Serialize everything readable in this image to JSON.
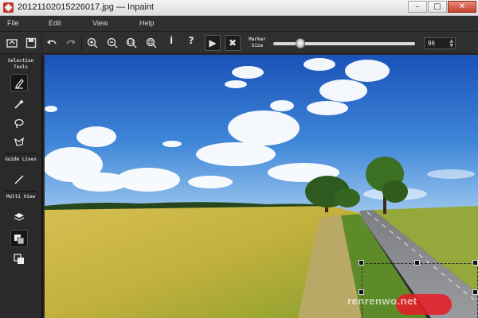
{
  "window": {
    "title": "20121102015226017.jpg — Inpaint",
    "controls": [
      "minimize",
      "maximize",
      "close"
    ]
  },
  "menu": [
    {
      "label": "File"
    },
    {
      "label": "Edit"
    },
    {
      "label": "View"
    },
    {
      "label": "Help"
    }
  ],
  "toolbar": {
    "buttons": [
      {
        "icon": "open-icon"
      },
      {
        "icon": "save-icon"
      },
      {
        "icon": "undo-icon"
      },
      {
        "icon": "redo-icon"
      },
      {
        "icon": "zoom-in-icon"
      },
      {
        "icon": "zoom-out-icon"
      },
      {
        "icon": "zoom-actual-icon"
      },
      {
        "icon": "zoom-fit-icon"
      },
      {
        "icon": "info-icon",
        "glyph": "i"
      },
      {
        "icon": "help-icon",
        "glyph": "?"
      },
      {
        "icon": "run-icon",
        "glyph": "▶"
      },
      {
        "icon": "cancel-icon",
        "glyph": "✖"
      }
    ],
    "marker_size_label": "Marker Size",
    "marker_size_value": "96",
    "marker_slider_level": 0.19
  },
  "sidebar": {
    "selection_label": "Selection Tools",
    "guide_label": "Guide Lines",
    "multiview_label": "Multi View",
    "tools": [
      {
        "icon": "marker-icon",
        "active": true
      },
      {
        "icon": "magic-wand-icon",
        "active": false
      },
      {
        "icon": "lasso-icon",
        "active": false
      },
      {
        "icon": "polygonal-lasso-icon",
        "active": false
      },
      {
        "icon": "guide-line-icon",
        "active": false
      },
      {
        "icon": "layers-icon",
        "active": false
      },
      {
        "icon": "multiview-split-icon",
        "active": true
      },
      {
        "icon": "multiview-single-icon",
        "active": false
      }
    ]
  },
  "canvas": {
    "watermark_text": "renrenwo.net",
    "colors": {
      "sky_top": "#1f5fc4",
      "sky_bottom": "#8fc0ef",
      "field": "#c9b548",
      "marker": "#e61e28"
    }
  }
}
